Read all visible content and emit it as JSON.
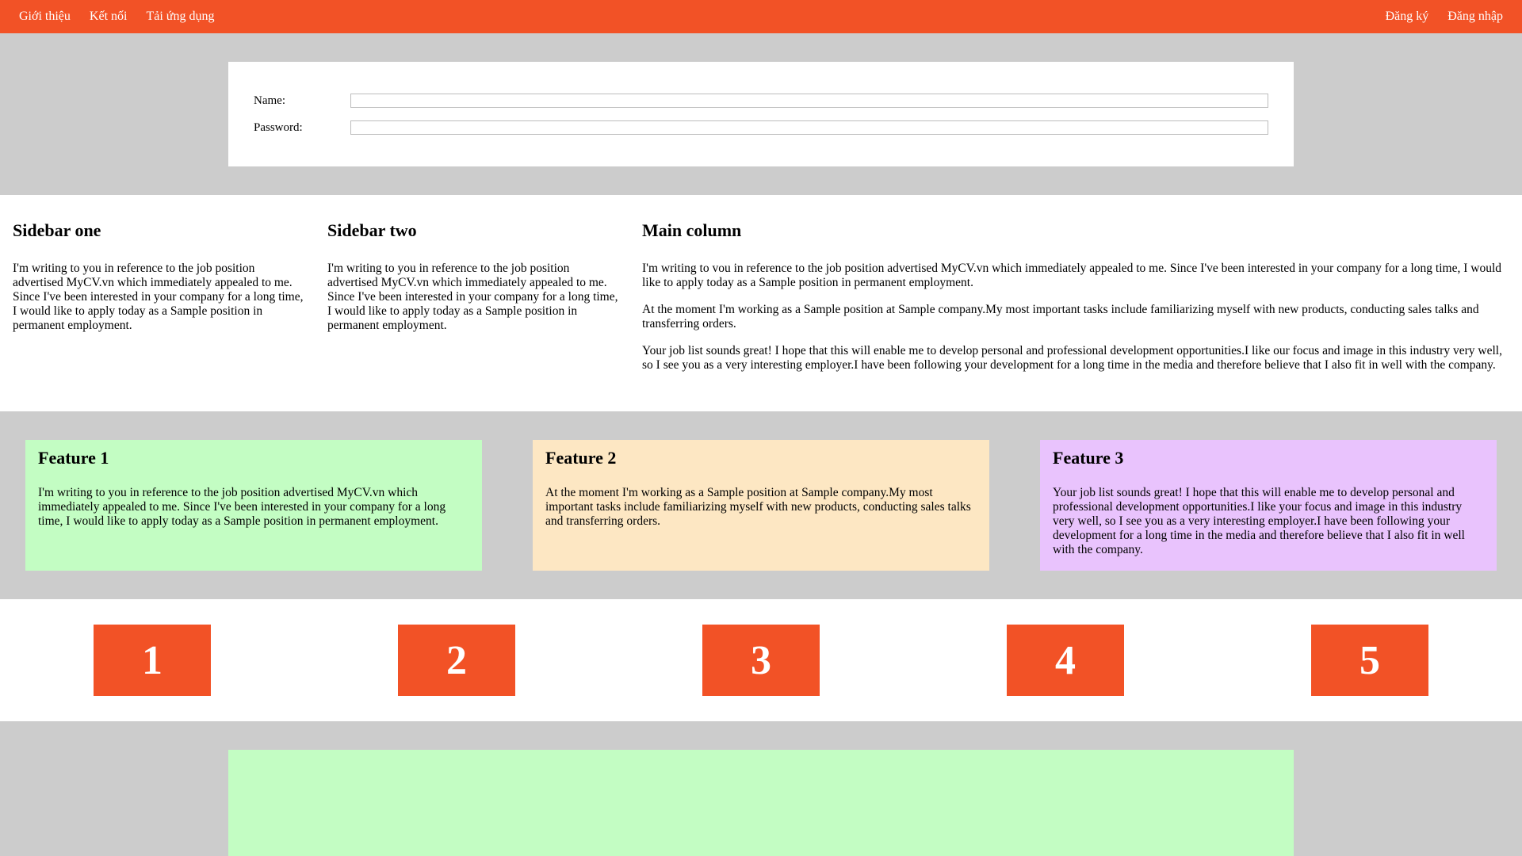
{
  "nav": {
    "left": [
      "Giới thiệu",
      "Kết nối",
      "Tải ứng dụng"
    ],
    "right": [
      "Đăng ký",
      "Đăng nhập"
    ]
  },
  "login": {
    "name_label": "Name:",
    "name_value": "",
    "password_label": "Password:",
    "password_value": ""
  },
  "columns": {
    "sidebar_one": {
      "title": "Sidebar one",
      "text": "I'm writing to you in reference to the job position advertised MyCV.vn which immediately appealed to me. Since I've been interested in your company for a long time, I would like to apply today as a Sample position in permanent employment."
    },
    "sidebar_two": {
      "title": "Sidebar two",
      "text": "I'm writing to you in reference to the job position advertised MyCV.vn which immediately appealed to me. Since I've been interested in your company for a long time, I would like to apply today as a Sample position in permanent employment."
    },
    "main": {
      "title": "Main column",
      "paragraphs": [
        "I'm writing to vou in reference to the job position advertised MyCV.vn which immediately appealed to me. Since I've been interested in your company for a long time, I would like to apply today as a Sample position in permanent employment.",
        "At the moment I'm working as a Sample position at Sample company.My most important tasks include familiarizing myself with new products, conducting sales talks and transferring orders.",
        "Your job list sounds great! I hope that this will enable me to develop personal and professional development opportunities.I like our focus and image in this industry very well, so I see you as a very interesting employer.I have been following your development for a long time in the media and therefore believe that I also fit in well with the company."
      ]
    }
  },
  "features": [
    {
      "title": "Feature 1",
      "text": "I'm writing to you in reference to the job position advertised MyCV.vn which immediately appealed to me. Since I've been interested in your company for a long time, I would like to apply today as a Sample position in permanent employment.",
      "color": "#c3fdc3"
    },
    {
      "title": "Feature 2",
      "text": "At the moment I'm working as a Sample position at Sample company.My most important tasks include familiarizing myself with new products, conducting sales talks and transferring orders.",
      "color": "#fde7c3"
    },
    {
      "title": "Feature 3",
      "text": "Your job list sounds great! I hope that this will enable me to develop personal and professional development opportunities.I like your focus and image in this industry very well, so I see you as a very interesting employer.I have been following your development for a long time in the media and therefore believe that I also fit in well with the company.",
      "color": "#e9c3fd"
    }
  ],
  "numbers": [
    "1",
    "2",
    "3",
    "4",
    "5"
  ],
  "colors": {
    "accent": "#f25226",
    "band": "#cccccc",
    "footer_panel": "#c3fdc3"
  }
}
